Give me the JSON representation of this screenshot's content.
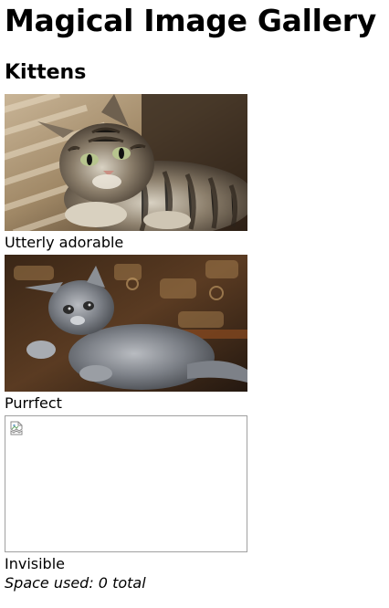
{
  "page": {
    "title": "Magical Image Gallery",
    "section_heading": "Kittens"
  },
  "gallery": {
    "images": [
      {
        "caption": "Utterly adorable",
        "state": "loaded",
        "subject": "tabby kitten lying on carpet in striped sunlight"
      },
      {
        "caption": "Purrfect",
        "state": "loaded",
        "subject": "grey fluffy kitten on patterned rug"
      },
      {
        "caption": "Invisible",
        "state": "broken",
        "icon": "broken-image-icon"
      }
    ]
  },
  "footer": {
    "space_used": "Space used: 0 total"
  }
}
